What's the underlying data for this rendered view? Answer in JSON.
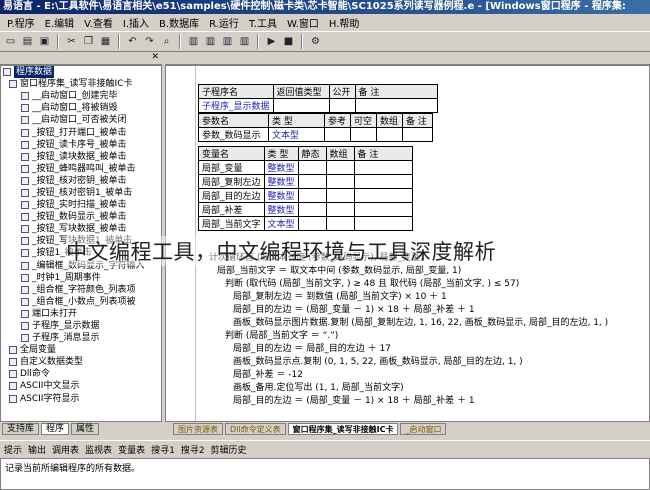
{
  "window": {
    "title": "易语言 - E:\\工具软件\\易语言相关\\e51\\samples\\硬件控制\\磁卡类\\芯卡智能\\SC1025系列读写器例程.e - [Windows窗口程序 - 程序集:"
  },
  "menu": [
    "P.程序",
    "E.编辑",
    "V.查看",
    "I.插入",
    "B.数据库",
    "R.运行",
    "T.工具",
    "W.窗口",
    "H.帮助"
  ],
  "toolbar_icons": [
    "new-icon",
    "open-icon",
    "save-icon",
    "cut-icon",
    "copy-icon",
    "paste-icon",
    "undo-icon",
    "redo-icon",
    "find-icon",
    "window1-icon",
    "window2-icon",
    "window3-icon",
    "window4-icon",
    "run-icon",
    "stop-icon",
    "compile-icon"
  ],
  "left_pane": {
    "header": "程序数据",
    "tree": [
      {
        "label": "程序数据",
        "selected": true
      },
      {
        "label": "窗口程序集_读写非接触IC卡"
      },
      {
        "label": "__启动窗口_创建完毕"
      },
      {
        "label": "__启动窗口_将被销毁"
      },
      {
        "label": "__启动窗口_可否被关闭"
      },
      {
        "label": "_按钮_打开端口_被单击"
      },
      {
        "label": "_按钮_读卡序号_被单击"
      },
      {
        "label": "_按钮_读块数据_被单击"
      },
      {
        "label": "_按钮_蜂鸣器鸣叫_被单击"
      },
      {
        "label": "_按钮_核对密钥_被单击"
      },
      {
        "label": "_按钮_核对密钥1_被单击"
      },
      {
        "label": "_按钮_实时扫描_被单击"
      },
      {
        "label": "_按钮_数码显示_被单击"
      },
      {
        "label": "_按钮_写块数据_被单击"
      },
      {
        "label": "_按钮_写块数据1_被单击"
      },
      {
        "label": "_按钮1_被单击"
      },
      {
        "label": "_编辑框_数码显示_字符输入"
      },
      {
        "label": "_时钟1_周期事件"
      },
      {
        "label": "_组合框_字符颜色_列表项"
      },
      {
        "label": "_组合框_小数点_列表项被"
      },
      {
        "label": "端口未打开"
      },
      {
        "label": "子程序_显示数据"
      },
      {
        "label": "子程序_消息显示"
      },
      {
        "label": "全局变量"
      },
      {
        "label": "自定义数据类型"
      },
      {
        "label": "Dll命令"
      },
      {
        "label": "ASCII中文显示"
      },
      {
        "label": "ASCII字符显示"
      }
    ]
  },
  "left_tabs": [
    "支持库",
    "程序",
    "属性"
  ],
  "editor": {
    "sub_table": {
      "headers": [
        "子程序名",
        "返回值类型",
        "公开",
        "备 注"
      ],
      "row": [
        "子程序_显示数据",
        "",
        "",
        ""
      ]
    },
    "param_table": {
      "headers": [
        "参数名",
        "类 型",
        "参考",
        "可空",
        "数组",
        "备 注"
      ],
      "row": [
        "参数_数码显示",
        "文本型",
        "",
        "",
        "",
        ""
      ]
    },
    "var_table": {
      "headers": [
        "变量名",
        "类 型",
        "静态",
        "数组",
        "备 注"
      ],
      "rows": [
        [
          "局部_变量",
          "整数型",
          "",
          "",
          ""
        ],
        [
          "局部_复制左边",
          "整数型",
          "",
          "",
          ""
        ],
        [
          "局部_目的左边",
          "整数型",
          "",
          "",
          ""
        ],
        [
          "局部_补差",
          "整数型",
          "",
          "",
          ""
        ],
        [
          "局部_当前文字",
          "文本型",
          "",
          "",
          ""
        ]
      ]
    },
    "code_lines": [
      "计次循环首 (取文本长度 (参数_数码显示), 局部_变量)",
      "局部_当前文字 ＝ 取文本中间 (参数_数码显示, 局部_变量, 1)",
      "判断 (取代码 (局部_当前文字, ) ≥ 48 且 取代码 (局部_当前文字, ) ≤ 57)",
      "局部_复制左边 ＝ 到数值 (局部_当前文字) × 10 ＋ 1",
      "局部_目的左边 ＝ (局部_变量 － 1) × 18 ＋ 局部_补差 ＋ 1",
      "画板_数码显示图片数据.复制 (局部_复制左边, 1, 16, 22, 画板_数码显示, 局部_目的左边, 1, )",
      "判断 (局部_当前文字 ＝ “.”)",
      "局部_目的左边 ＝ 局部_目的左边 ＋ 17",
      "画板_数码显示点.复制 (0, 1, 5, 22, 画板_数码显示, 局部_目的左边, 1, )",
      "局部_补差 ＝ -12",
      "画板_备用.定位写出 (1, 1, 局部_当前文字)",
      "局部_目的左边 ＝ (局部_变量 － 1) × 18 ＋ 局部_补差 ＋ 1"
    ],
    "watermark": "中文编程工具，中文编程环境与工具深度解析"
  },
  "editor_tabs": [
    {
      "label": "图片资源表"
    },
    {
      "label": "Dll命令定义表"
    },
    {
      "label": "窗口程序集_读写非接触IC卡",
      "active": true
    },
    {
      "label": "_启动窗口"
    }
  ],
  "bottom_tabs": [
    "提示",
    "输出",
    "调用表",
    "监视表",
    "变量表",
    "搜寻1",
    "搜寻2",
    "剪辑历史"
  ],
  "output_text": "记录当前所编辑程序的所有数据。"
}
